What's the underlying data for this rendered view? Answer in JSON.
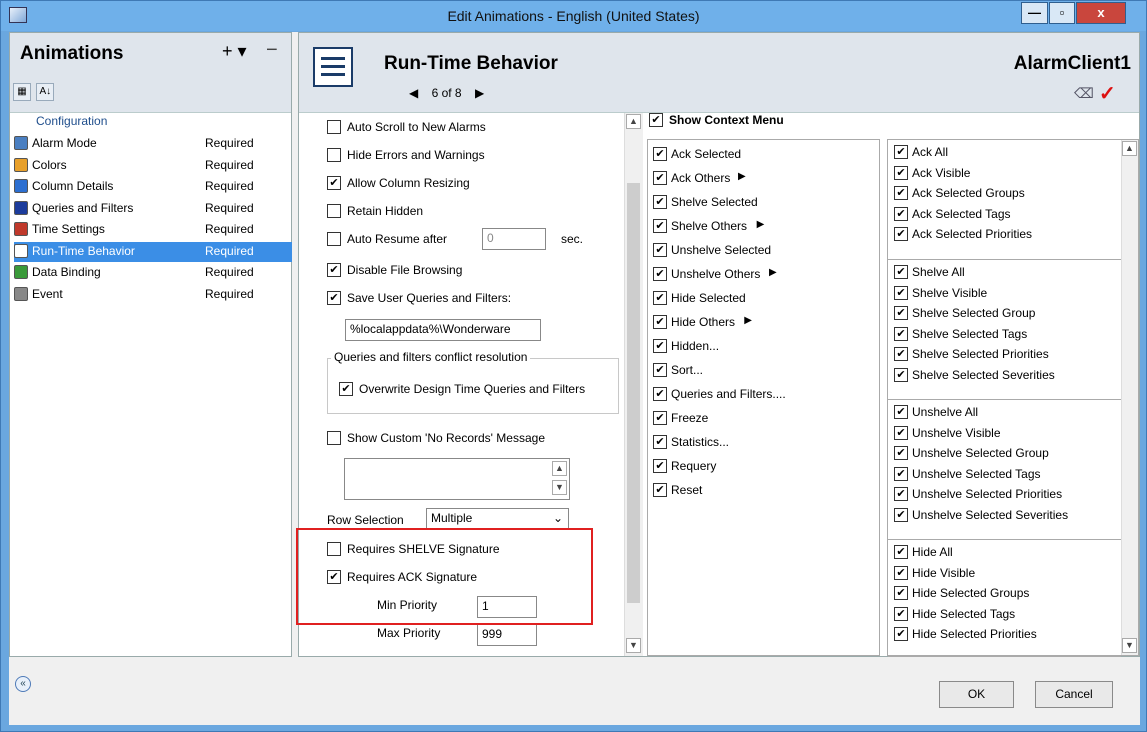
{
  "window": {
    "title": "Edit Animations - English (United States)",
    "min_label": "—",
    "max_label": "▫",
    "close_label": "x"
  },
  "left_panel": {
    "title": "Animations",
    "plus_label": "+ ▾",
    "minus_label": "−",
    "sort_cat_label": "▦",
    "sort_az_label": "A↓",
    "section": "Configuration",
    "items": [
      {
        "label": "Alarm Mode",
        "status": "Required",
        "icon": "alarm-mode-icon",
        "color": "#4a7fc1"
      },
      {
        "label": "Colors",
        "status": "Required",
        "icon": "colors-icon",
        "color": "#e8a02a"
      },
      {
        "label": "Column Details",
        "status": "Required",
        "icon": "column-details-icon",
        "color": "#2c6fd1"
      },
      {
        "label": "Queries and Filters",
        "status": "Required",
        "icon": "filter-icon",
        "color": "#1c3c9c"
      },
      {
        "label": "Time Settings",
        "status": "Required",
        "icon": "time-settings-icon",
        "color": "#c0392b"
      },
      {
        "label": "Run-Time Behavior",
        "status": "Required",
        "icon": "run-time-behavior-icon",
        "color": "#ffffff"
      },
      {
        "label": "Data Binding",
        "status": "Required",
        "icon": "data-binding-icon",
        "color": "#3a9a3a"
      },
      {
        "label": "Event",
        "status": "Required",
        "icon": "event-icon",
        "color": "#888888"
      }
    ],
    "selected_index": 5
  },
  "header": {
    "title": "Run-Time Behavior",
    "page": "6 of 8",
    "prev": "◀",
    "next": "▶",
    "client_name": "AlarmClient1",
    "eraser_label": "⌫",
    "accept_label": "✓"
  },
  "options": {
    "auto_scroll": {
      "label": "Auto Scroll to New Alarms",
      "checked": false
    },
    "hide_errors": {
      "label": "Hide Errors and Warnings",
      "checked": false
    },
    "allow_resize": {
      "label": "Allow Column Resizing",
      "checked": true
    },
    "retain_hidden": {
      "label": "Retain Hidden",
      "checked": false
    },
    "auto_resume": {
      "label": "Auto Resume after",
      "checked": false,
      "value": "0",
      "unit": "sec."
    },
    "disable_browsing": {
      "label": "Disable File Browsing",
      "checked": true
    },
    "save_queries": {
      "label": "Save User Queries and Filters:",
      "checked": true,
      "path": "%localappdata%\\Wonderware"
    },
    "conflict_group": {
      "title": "Queries and filters conflict resolution",
      "overwrite_label": "Overwrite Design Time Queries and Filters",
      "checked": true
    },
    "show_custom": {
      "label": "Show Custom 'No Records' Message",
      "checked": false
    },
    "row_selection": {
      "label": "Row Selection",
      "value": "Multiple"
    },
    "requires_shelve": {
      "label": "Requires SHELVE Signature",
      "checked": false
    },
    "requires_ack": {
      "label": "Requires ACK Signature",
      "checked": true
    },
    "min_priority": {
      "label": "Min Priority",
      "value": "1"
    },
    "max_priority": {
      "label": "Max Priority",
      "value": "999"
    }
  },
  "context_menu": {
    "label": "Show Context Menu",
    "checked": true,
    "items": [
      {
        "label": "Ack Selected",
        "sub": false
      },
      {
        "label": "Ack Others",
        "sub": true
      },
      {
        "label": "Shelve Selected",
        "sub": false
      },
      {
        "label": "Shelve Others",
        "sub": true
      },
      {
        "label": "Unshelve Selected",
        "sub": false
      },
      {
        "label": "Unshelve Others",
        "sub": true
      },
      {
        "label": "Hide Selected",
        "sub": false
      },
      {
        "label": "Hide Others",
        "sub": true
      },
      {
        "label": "Hidden...",
        "sub": false
      },
      {
        "label": "Sort...",
        "sub": false
      },
      {
        "label": "Queries and Filters....",
        "sub": false
      },
      {
        "label": "Freeze",
        "sub": false
      },
      {
        "label": "Statistics...",
        "sub": false
      },
      {
        "label": "Requery",
        "sub": false
      },
      {
        "label": "Reset",
        "sub": false
      }
    ],
    "submenu_groups": [
      [
        "Ack All",
        "Ack Visible",
        "Ack Selected Groups",
        "Ack Selected Tags",
        "Ack Selected Priorities"
      ],
      [
        "Shelve All",
        "Shelve Visible",
        "Shelve Selected Group",
        "Shelve Selected Tags",
        "Shelve Selected Priorities",
        "Shelve Selected Severities"
      ],
      [
        "Unshelve All",
        "Unshelve Visible",
        "Unshelve Selected Group",
        "Unshelve Selected Tags",
        "Unshelve Selected Priorities",
        "Unshelve Selected Severities"
      ],
      [
        "Hide All",
        "Hide Visible",
        "Hide Selected Groups",
        "Hide Selected Tags",
        "Hide Selected Priorities"
      ]
    ]
  },
  "footer": {
    "back_label": "«",
    "ok": "OK",
    "cancel": "Cancel"
  }
}
